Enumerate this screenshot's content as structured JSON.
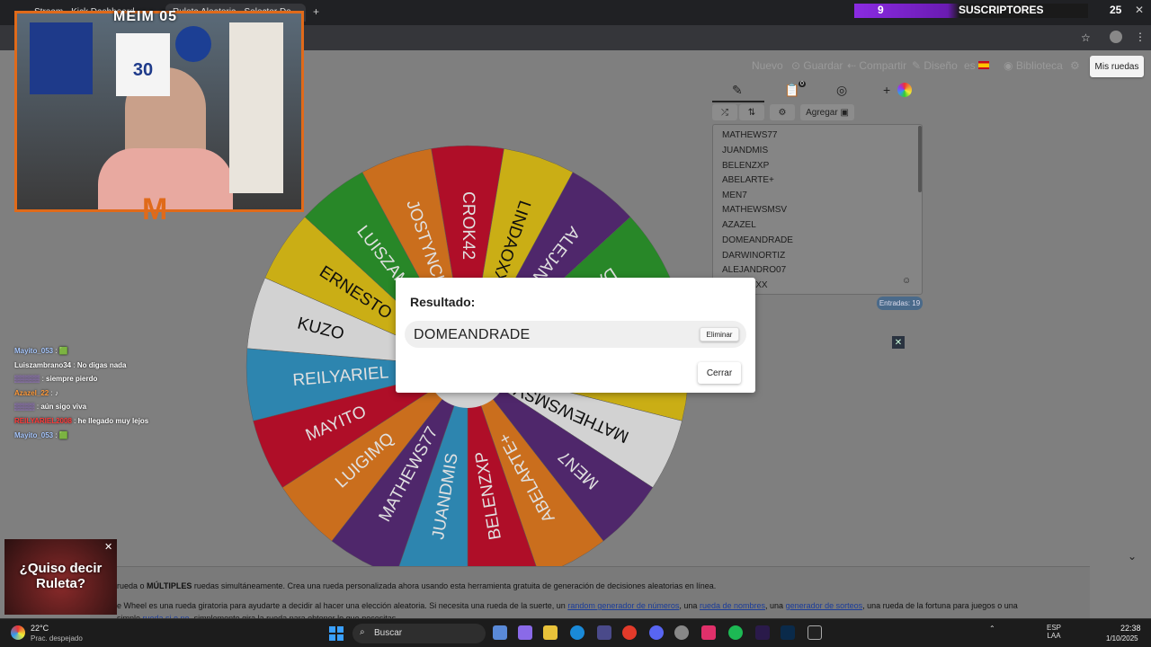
{
  "browser": {
    "tabs": [
      "Stream - Kick Dashboard",
      "Ruleta Aleatoria - Selector De..."
    ],
    "new_tab": "+",
    "window_controls": [
      "—",
      "▢",
      "✕"
    ]
  },
  "overlay": {
    "cam_title": "MEIM 05",
    "subs_count": "9",
    "subs_label": "SUSCRIPTORES",
    "subs_goal": "25",
    "quiso_text": "¿Quiso decir Ruleta?"
  },
  "toolbar": {
    "nuevo": "Nuevo",
    "guardar": "Guardar",
    "compartir": "Compartir",
    "diseno": "Diseño",
    "lang": "es",
    "biblioteca": "Biblioteca",
    "mis_ruedas": "Mis ruedas"
  },
  "panel": {
    "agregar": "Agregar",
    "badge": "0",
    "entries": [
      "MATHEWS77",
      "JUANDMIS",
      "BELENZXP",
      "ABELARTE+",
      "MEN7",
      "MATHEWSMSV",
      "AZAZEL",
      "DOMEANDRADE",
      "DARWINORTIZ",
      "ALEJANDRO07",
      "LINDAOXX"
    ],
    "entradas": "Entradas: 19"
  },
  "wheel": {
    "segments": [
      {
        "label": "CROK42",
        "color": "#c8102e"
      },
      {
        "label": "LINDAOXX",
        "color": "#e6c619"
      },
      {
        "label": "ALEJANDRO07",
        "color": "#5a2d7a"
      },
      {
        "label": "DARWINORTIZ",
        "color": "#2e9a2e"
      },
      {
        "label": "DOMEANDRADE",
        "color": "#c8102e"
      },
      {
        "label": "AZAZEL",
        "color": "#e6c619"
      },
      {
        "label": "MATHEWSMSV",
        "color": "#f0f0f0"
      },
      {
        "label": "MEN7",
        "color": "#5a2d7a"
      },
      {
        "label": "ABELARTE+",
        "color": "#e67e22"
      },
      {
        "label": "BELENZXP",
        "color": "#c8102e"
      },
      {
        "label": "JUANDMIS",
        "color": "#3498c8"
      },
      {
        "label": "MATHEWS77",
        "color": "#5a2d7a"
      },
      {
        "label": "LUIGIMQ",
        "color": "#e67e22"
      },
      {
        "label": "MAYITO",
        "color": "#c8102e"
      },
      {
        "label": "REILYARIEL",
        "color": "#3498c8"
      },
      {
        "label": "KUZO",
        "color": "#f0f0f0"
      },
      {
        "label": "ERNESTO",
        "color": "#e6c619"
      },
      {
        "label": "LUISZAMBRANO",
        "color": "#2e9a2e"
      },
      {
        "label": "JOSTYNCHIC",
        "color": "#e67e22"
      }
    ]
  },
  "modal": {
    "title": "Resultado:",
    "result": "DOMEANDRADE",
    "eliminar": "Eliminar",
    "cerrar": "Cerrar"
  },
  "info": {
    "line1_pre": "rueda o",
    "line1_bold": "MÚLTIPLES",
    "line1_post": "ruedas simultáneamente. Crea una rueda personalizada ahora usando esta herramienta gratuita de generación de decisiones aleatorias en línea.",
    "line2_pre": "e Wheel es una rueda giratoria para ayudarte a decidir al hacer una elección aleatoria. Si necesita una rueda de la suerte, un",
    "link1": "random generador de números",
    "mid1": ", una",
    "link2": "rueda de nombres",
    "mid2": ", una",
    "link3": "generador de sorteos",
    "line2_post": ", una rueda de la fortuna para juegos o una",
    "line3_pre": "simple",
    "link4": "rueda si o no",
    "line3_post": ", simplemente gira la rueda para obtener lo que necesitas."
  },
  "chat": [
    {
      "user": "Mayito_053",
      "msg": "",
      "color": "#a8c8ff"
    },
    {
      "user": "Luiszambrano34",
      "msg": "No digas nada",
      "color": "#ffffff"
    },
    {
      "user": "",
      "msg": "siempre pierdo",
      "color": "#b37cff"
    },
    {
      "user": "Azazel_22",
      "msg": "",
      "color": "#ff9a3a"
    },
    {
      "user": "",
      "msg": "aún sigo viva",
      "color": "#b37cff"
    },
    {
      "user": "REILYARIEL2008",
      "msg": "he llegado muy lejos",
      "color": "#ff3a3a"
    },
    {
      "user": "Mayito_053",
      "msg": "",
      "color": "#a8c8ff"
    }
  ],
  "taskbar": {
    "temp": "22°C",
    "weather": "Prac. despejado",
    "search": "Buscar",
    "lang_top": "ESP",
    "lang_bottom": "LAA",
    "time": "22:38",
    "date": "1/10/2025"
  },
  "colors": {
    "accent_orange": "#e06a1a",
    "subs_purple": "#8a2be2"
  }
}
